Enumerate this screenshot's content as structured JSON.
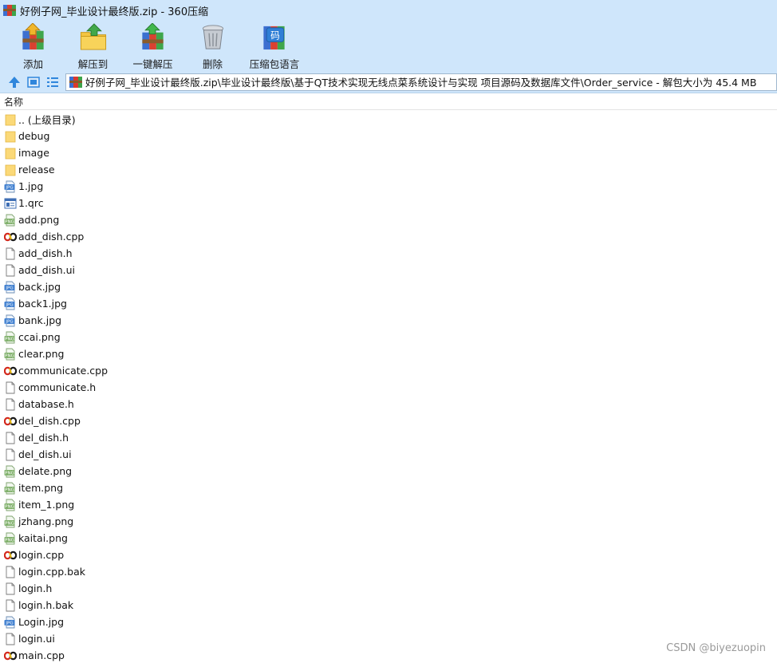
{
  "window": {
    "title": "好例子网_毕业设计最终版.zip - 360压缩"
  },
  "toolbar": [
    {
      "label": "添加",
      "icon": "add-archive-icon"
    },
    {
      "label": "解压到",
      "icon": "extract-to-icon"
    },
    {
      "label": "一键解压",
      "icon": "one-click-extract-icon"
    },
    {
      "label": "删除",
      "icon": "delete-icon"
    },
    {
      "label": "压缩包语言",
      "icon": "archive-language-icon"
    }
  ],
  "address": {
    "path": "好例子网_毕业设计最终版.zip\\毕业设计最终版\\基于QT技术实现无线点菜系统设计与实现 项目源码及数据库文件\\Order_service - 解包大小为 45.4 MB"
  },
  "list": {
    "header": "名称",
    "files": [
      {
        "name": ".. (上级目录)",
        "type": "folder"
      },
      {
        "name": "debug",
        "type": "folder"
      },
      {
        "name": "image",
        "type": "folder"
      },
      {
        "name": "release",
        "type": "folder"
      },
      {
        "name": "1.jpg",
        "type": "jpg"
      },
      {
        "name": "1.qrc",
        "type": "qrc"
      },
      {
        "name": "add.png",
        "type": "png"
      },
      {
        "name": "add_dish.cpp",
        "type": "cpp"
      },
      {
        "name": "add_dish.h",
        "type": "file"
      },
      {
        "name": "add_dish.ui",
        "type": "file"
      },
      {
        "name": "back.jpg",
        "type": "jpg"
      },
      {
        "name": "back1.jpg",
        "type": "jpg"
      },
      {
        "name": "bank.jpg",
        "type": "jpg"
      },
      {
        "name": "ccai.png",
        "type": "png"
      },
      {
        "name": "clear.png",
        "type": "png"
      },
      {
        "name": "communicate.cpp",
        "type": "cpp"
      },
      {
        "name": "communicate.h",
        "type": "file"
      },
      {
        "name": "database.h",
        "type": "file"
      },
      {
        "name": "del_dish.cpp",
        "type": "cpp"
      },
      {
        "name": "del_dish.h",
        "type": "file"
      },
      {
        "name": "del_dish.ui",
        "type": "file"
      },
      {
        "name": "delate.png",
        "type": "png"
      },
      {
        "name": "item.png",
        "type": "png"
      },
      {
        "name": "item_1.png",
        "type": "png"
      },
      {
        "name": "jzhang.png",
        "type": "png"
      },
      {
        "name": "kaitai.png",
        "type": "png"
      },
      {
        "name": "login.cpp",
        "type": "cpp"
      },
      {
        "name": "login.cpp.bak",
        "type": "file"
      },
      {
        "name": "login.h",
        "type": "file"
      },
      {
        "name": "login.h.bak",
        "type": "file"
      },
      {
        "name": "Login.jpg",
        "type": "jpg"
      },
      {
        "name": "login.ui",
        "type": "file"
      },
      {
        "name": "main.cpp",
        "type": "cpp"
      }
    ]
  },
  "watermark": "CSDN @biyezuopin"
}
